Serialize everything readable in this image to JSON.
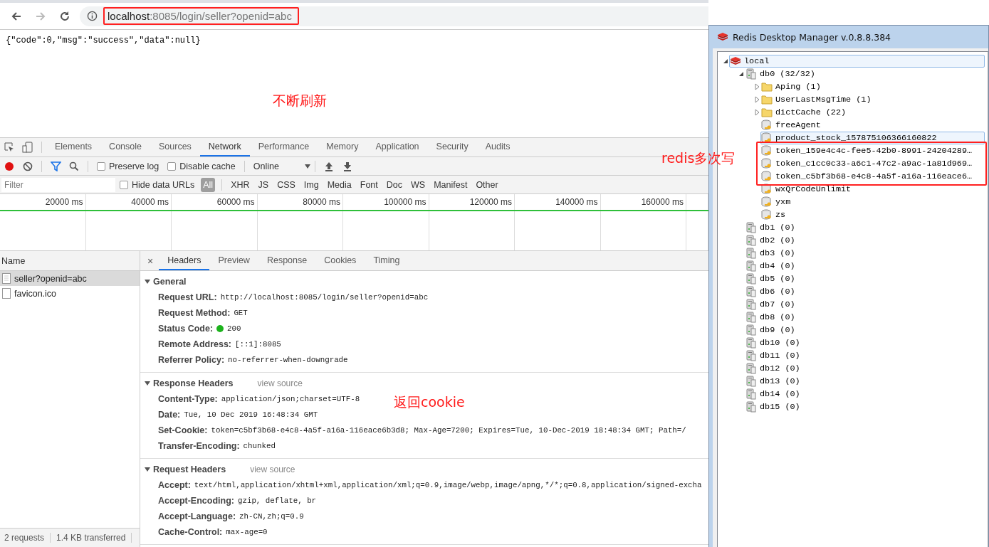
{
  "browser": {
    "address": {
      "host": "localhost",
      "rest": ":8085/login/seller?openid=abc"
    },
    "page_body": "{\"code\":0,\"msg\":\"success\",\"data\":null}",
    "devtools": {
      "main_tabs": [
        {
          "label": "Elements",
          "selected": false
        },
        {
          "label": "Console",
          "selected": false
        },
        {
          "label": "Sources",
          "selected": false
        },
        {
          "label": "Network",
          "selected": true
        },
        {
          "label": "Performance",
          "selected": false
        },
        {
          "label": "Memory",
          "selected": false
        },
        {
          "label": "Application",
          "selected": false
        },
        {
          "label": "Security",
          "selected": false
        },
        {
          "label": "Audits",
          "selected": false
        }
      ],
      "toolbar": {
        "recording": true,
        "filter_on": true,
        "preserve_log": {
          "label": "Preserve log",
          "checked": false
        },
        "disable_cache": {
          "label": "Disable cache",
          "checked": false
        },
        "throttling": "Online"
      },
      "filter": {
        "placeholder": "Filter",
        "hide_data_urls": {
          "label": "Hide data URLs",
          "checked": false
        },
        "types": [
          {
            "label": "All",
            "selected": true
          },
          {
            "label": "XHR",
            "selected": false
          },
          {
            "label": "JS",
            "selected": false
          },
          {
            "label": "CSS",
            "selected": false
          },
          {
            "label": "Img",
            "selected": false
          },
          {
            "label": "Media",
            "selected": false
          },
          {
            "label": "Font",
            "selected": false
          },
          {
            "label": "Doc",
            "selected": false
          },
          {
            "label": "WS",
            "selected": false
          },
          {
            "label": "Manifest",
            "selected": false
          },
          {
            "label": "Other",
            "selected": false
          }
        ]
      },
      "timeline_ticks": [
        "20000 ms",
        "40000 ms",
        "60000 ms",
        "80000 ms",
        "100000 ms",
        "120000 ms",
        "140000 ms",
        "160000 ms"
      ],
      "requests": {
        "header": "Name",
        "rows": [
          {
            "name": "seller?openid=abc",
            "selected": true
          },
          {
            "name": "favicon.ico",
            "selected": false
          }
        ],
        "summary": [
          "2 requests",
          "1.4 KB transferred"
        ]
      },
      "detail": {
        "close": "×",
        "tabs": [
          {
            "label": "Headers",
            "selected": true
          },
          {
            "label": "Preview",
            "selected": false
          },
          {
            "label": "Response",
            "selected": false
          },
          {
            "label": "Cookies",
            "selected": false
          },
          {
            "label": "Timing",
            "selected": false
          }
        ],
        "sections": [
          {
            "title": "General",
            "expanded": true,
            "rows": [
              {
                "name": "Request URL:",
                "value": "http://localhost:8085/login/seller?openid=abc",
                "kind": "text"
              },
              {
                "name": "Request Method:",
                "value": "GET",
                "kind": "text"
              },
              {
                "name": "Status Code:",
                "value": "200",
                "kind": "status"
              },
              {
                "name": "Remote Address:",
                "value": "[::1]:8085",
                "kind": "text"
              },
              {
                "name": "Referrer Policy:",
                "value": "no-referrer-when-downgrade",
                "kind": "text"
              }
            ]
          },
          {
            "title": "Response Headers",
            "link": "view source",
            "expanded": true,
            "rows": [
              {
                "name": "Content-Type:",
                "value": "application/json;charset=UTF-8",
                "kind": "text"
              },
              {
                "name": "Date:",
                "value": "Tue, 10 Dec 2019 16:48:34 GMT",
                "kind": "text"
              },
              {
                "name": "Set-Cookie:",
                "value": "token=c5bf3b68-e4c8-4a5f-a16a-116eace6b3d8; Max-Age=7200; Expires=Tue, 10-Dec-2019 18:48:34 GMT; Path=/",
                "kind": "text"
              },
              {
                "name": "Transfer-Encoding:",
                "value": "chunked",
                "kind": "text"
              }
            ]
          },
          {
            "title": "Request Headers",
            "link": "view source",
            "expanded": true,
            "rows": [
              {
                "name": "Accept:",
                "value": "text/html,application/xhtml+xml,application/xml;q=0.9,image/webp,image/apng,*/*;q=0.8,application/signed-excha",
                "kind": "text"
              },
              {
                "name": "Accept-Encoding:",
                "value": "gzip, deflate, br",
                "kind": "text"
              },
              {
                "name": "Accept-Language:",
                "value": "zh-CN,zh;q=0.9",
                "kind": "text"
              },
              {
                "name": "Cache-Control:",
                "value": "max-age=0",
                "kind": "text"
              }
            ]
          }
        ]
      }
    }
  },
  "redis": {
    "title": "Redis Desktop Manager v.0.8.8.384",
    "tree": [
      {
        "label": "local",
        "kind": "server",
        "expanded": true,
        "selected": true,
        "children": [
          {
            "label": "db0  (32/32)",
            "kind": "db",
            "expanded": true,
            "selected": false,
            "children": [
              {
                "label": "Aping (1)",
                "kind": "folder",
                "expanded": false,
                "selected": false
              },
              {
                "label": "UserLastMsgTime (1)",
                "kind": "folder",
                "expanded": false,
                "selected": false
              },
              {
                "label": "dictCache (22)",
                "kind": "folder",
                "expanded": false,
                "selected": false
              },
              {
                "label": "freeAgent",
                "kind": "key",
                "selected": false
              },
              {
                "label": "product_stock_157875106366160822",
                "kind": "key",
                "selected": true
              },
              {
                "label": "token_159e4c4c-fee5-42b0-8991-24204289…",
                "kind": "key",
                "selected": false
              },
              {
                "label": "token_c1cc0c33-a6c1-47c2-a9ac-1a81d969…",
                "kind": "key",
                "selected": false
              },
              {
                "label": "token_c5bf3b68-e4c8-4a5f-a16a-116eace6…",
                "kind": "key",
                "selected": false
              },
              {
                "label": "wxQrCodeUnlimit",
                "kind": "key",
                "selected": false
              },
              {
                "label": "yxm",
                "kind": "key",
                "selected": false
              },
              {
                "label": "zs",
                "kind": "key",
                "selected": false
              }
            ]
          },
          {
            "label": "db1 (0)",
            "kind": "db",
            "selected": false
          },
          {
            "label": "db2 (0)",
            "kind": "db",
            "selected": false
          },
          {
            "label": "db3 (0)",
            "kind": "db",
            "selected": false
          },
          {
            "label": "db4 (0)",
            "kind": "db",
            "selected": false
          },
          {
            "label": "db5 (0)",
            "kind": "db",
            "selected": false
          },
          {
            "label": "db6 (0)",
            "kind": "db",
            "selected": false
          },
          {
            "label": "db7 (0)",
            "kind": "db",
            "selected": false
          },
          {
            "label": "db8 (0)",
            "kind": "db",
            "selected": false
          },
          {
            "label": "db9 (0)",
            "kind": "db",
            "selected": false
          },
          {
            "label": "db10 (0)",
            "kind": "db",
            "selected": false
          },
          {
            "label": "db11 (0)",
            "kind": "db",
            "selected": false
          },
          {
            "label": "db12 (0)",
            "kind": "db",
            "selected": false
          },
          {
            "label": "db13 (0)",
            "kind": "db",
            "selected": false
          },
          {
            "label": "db14 (0)",
            "kind": "db",
            "selected": false
          },
          {
            "label": "db15 (0)",
            "kind": "db",
            "selected": false
          }
        ]
      }
    ]
  },
  "annotations": [
    {
      "text": "不断刷新"
    },
    {
      "text": "redis多次写"
    },
    {
      "text": "返回cookie"
    }
  ]
}
